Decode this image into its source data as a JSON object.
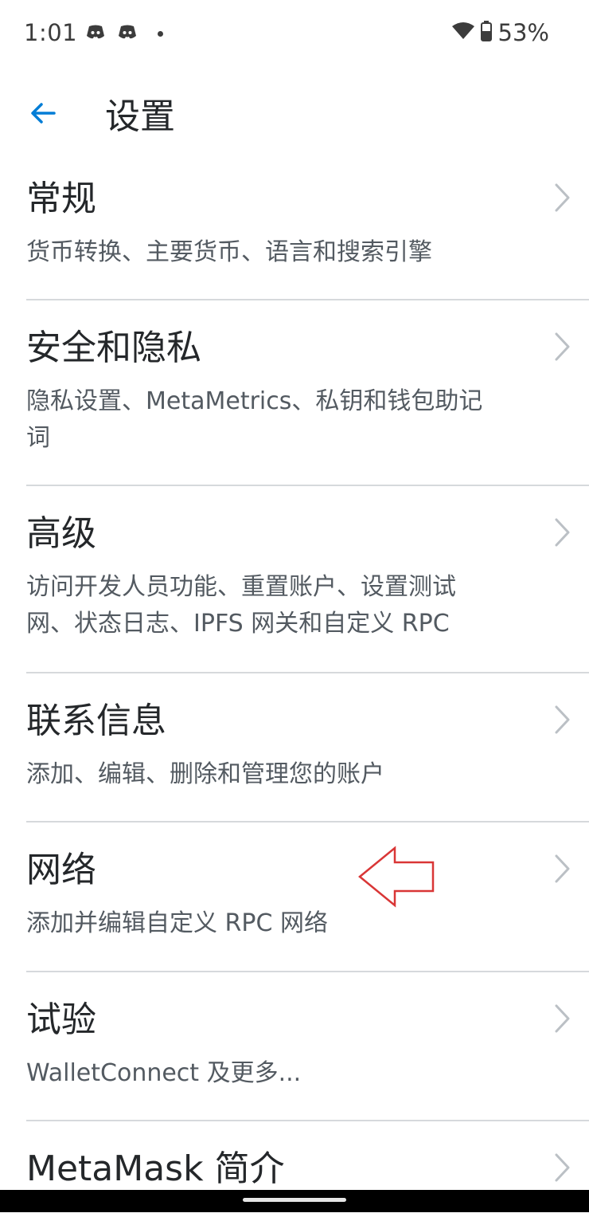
{
  "status_bar": {
    "time": "1:01",
    "battery": "53%",
    "left_icons": [
      "discord-icon",
      "discord-icon"
    ],
    "right_icons": [
      "wifi-icon",
      "battery-icon"
    ]
  },
  "header": {
    "back_icon": "arrow-left-icon",
    "title": "设置"
  },
  "settings": [
    {
      "title": "常规",
      "desc": "货币转换、主要货币、语言和搜索引擎"
    },
    {
      "title": "安全和隐私",
      "desc": "隐私设置、MetaMetrics、私钥和钱包助记词"
    },
    {
      "title": "高级",
      "desc": "访问开发人员功能、重置账户、设置测试网、状态日志、IPFS 网关和自定义 RPC"
    },
    {
      "title": "联系信息",
      "desc": "添加、编辑、删除和管理您的账户"
    },
    {
      "title": "网络",
      "desc": "添加并编辑自定义 RPC 网络"
    },
    {
      "title": "试验",
      "desc": "WalletConnect 及更多..."
    },
    {
      "title": "MetaMask 简介",
      "desc": ""
    }
  ],
  "colors": {
    "accent": "#037dd6",
    "annotation_arrow": "#d93636",
    "divider": "#d6d9dc"
  }
}
